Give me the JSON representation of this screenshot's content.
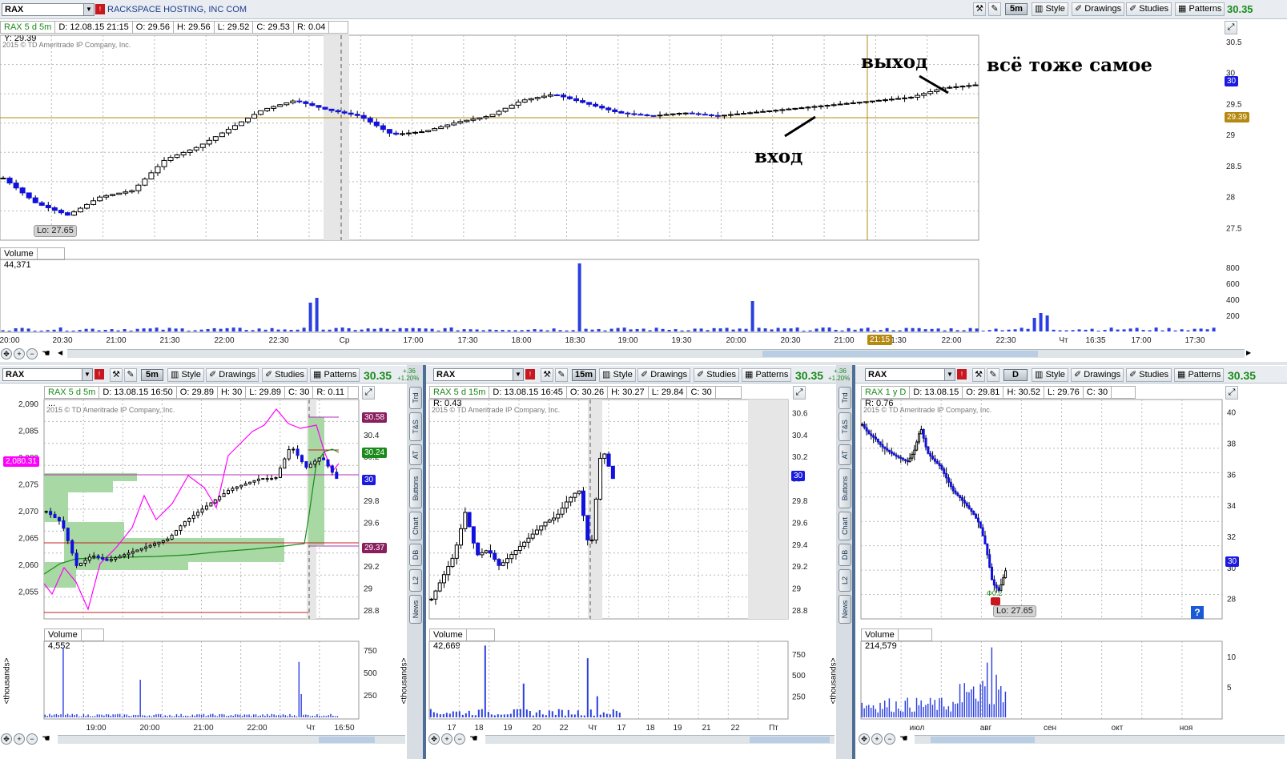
{
  "top": {
    "symbol": "RAX",
    "company": "RACKSPACE HOSTING, INC COM",
    "timeframe": "5m",
    "style_label": "Style",
    "drawings_label": "Drawings",
    "studies_label": "Studies",
    "patterns_label": "Patterns",
    "last_price": "30.35",
    "info": {
      "title": "RAX 5 d 5m",
      "d": "D: 12.08.15 21:15",
      "o": "O: 29.56",
      "h": "H: 29.56",
      "l": "L: 29.52",
      "c": "C: 29.53",
      "r": "R: 0.04",
      "y": "Y: 29.39"
    },
    "copyright": "2015 © TD Ameritrade IP Company, Inc.",
    "lo_tag": "Lo: 27.65",
    "price_axis": [
      "30.5",
      "30",
      "29.5",
      "29",
      "28.5",
      "28",
      "27.5"
    ],
    "current_price_label": "30",
    "ref_price_label": "29.39",
    "volume_label": "Volume",
    "volume_value": "44,371",
    "volume_axis": [
      "800",
      "600",
      "400",
      "200"
    ],
    "time_axis": [
      "20:00",
      "20:30",
      "21:00",
      "21:30",
      "22:00",
      "22:30",
      "Ср",
      "17:00",
      "17:30",
      "18:00",
      "18:30",
      "19:00",
      "19:30",
      "20:00",
      "20:30",
      "21:00",
      "21:15",
      "1:30",
      "22:00",
      "22:30",
      "Чт",
      "16:35",
      "17:00",
      "17:30"
    ],
    "annotations": {
      "exit": "выход",
      "same": "всё тоже самое",
      "entry": "вход"
    }
  },
  "panels": [
    {
      "symbol": "RAX",
      "timeframe": "5m",
      "style_label": "Style",
      "drawings_label": "Drawings",
      "studies_label": "Studies",
      "patterns_label": "Patterns",
      "last_price": "30.35",
      "change": "+.36",
      "change_pct": "+1.20%",
      "info": {
        "title": "RAX 5 d 5m",
        "d": "D: 13.08.15 16:50",
        "o": "O: 29.89",
        "h": "H: 30",
        "l": "L: 29.89",
        "c": "C: 30",
        "r": "R: 0.11",
        "more": "..."
      },
      "copyright": "2015 © TD Ameritrade IP Company, Inc.",
      "left_axis": [
        "2,090",
        "2,085",
        "2,080",
        "2,075",
        "2,070",
        "2,065",
        "2,060",
        "2,055"
      ],
      "left_tag": "2,080.31",
      "right_axis": [
        "30.4",
        "30.2",
        "29.8",
        "29.6",
        "29.2",
        "29",
        "28.8"
      ],
      "right_tags": [
        "30.58",
        "30.24",
        "30",
        "29.37"
      ],
      "volume_label": "Volume",
      "volume_value": "4,552",
      "volume_axis": [
        "750",
        "500",
        "250"
      ],
      "thousands_label": "<thousands>",
      "time_axis": [
        "19:00",
        "20:00",
        "21:00",
        "22:00",
        "Чт",
        "16:50"
      ]
    },
    {
      "symbol": "RAX",
      "timeframe": "15m",
      "style_label": "Style",
      "drawings_label": "Drawings",
      "studies_label": "Studies",
      "patterns_label": "Patterns",
      "last_price": "30.35",
      "change": "+.36",
      "change_pct": "+1.20%",
      "info": {
        "title": "RAX 5 d 15m",
        "d": "D: 13.08.15 16:45",
        "o": "O: 30.26",
        "h": "H: 30.27",
        "l": "L: 29.84",
        "c": "C: 30",
        "r": "R: 0.43"
      },
      "copyright": "2015 © TD Ameritrade IP Company, Inc.",
      "right_axis": [
        "30.6",
        "30.4",
        "30.2",
        "30",
        "29.8",
        "29.6",
        "29.4",
        "29.2",
        "29",
        "28.8"
      ],
      "volume_label": "Volume",
      "volume_value": "42,669",
      "volume_axis": [
        "750",
        "500",
        "250"
      ],
      "thousands_label": "<thousands>",
      "time_axis": [
        "17",
        "18",
        "19",
        "20",
        "22",
        "Чт",
        "17",
        "18",
        "19",
        "21",
        "22",
        "Пт"
      ]
    },
    {
      "symbol": "RAX",
      "timeframe": "D",
      "style_label": "Style",
      "drawings_label": "Drawings",
      "studies_label": "Studies",
      "patterns_label": "Patterns",
      "last_price": "30.35",
      "info": {
        "title": "RAX 1 y D",
        "d": "D: 13.08.15",
        "o": "O: 29.81",
        "h": "H: 30.52",
        "l": "L: 29.76",
        "c": "C: 30",
        "r": "R: 0.76"
      },
      "copyright": "2015 © TD Ameritrade IP Company, Inc.",
      "right_axis": [
        "40",
        "38",
        "36",
        "34",
        "32",
        "30",
        "28"
      ],
      "lo_tag": "Lo: 27.65",
      "div_label": "Ф0.2",
      "volume_label": "Volume",
      "volume_value": "214,579",
      "volume_axis": [
        "10",
        "5"
      ],
      "time_axis": [
        "июл",
        "авг",
        "сен",
        "окт",
        "ноя"
      ]
    }
  ],
  "side_tabs": [
    "Trd",
    "T&S",
    "AT",
    "Buttons",
    "Chart",
    "DB",
    "L2",
    "News"
  ],
  "colors": {
    "up": "#ffffff",
    "down": "#1010e0",
    "volume": "#2a3fe0",
    "green": "#1a8a1a",
    "magenta": "#ff00ff",
    "gold": "#b5890f",
    "grid": "#b8b8b8"
  }
}
